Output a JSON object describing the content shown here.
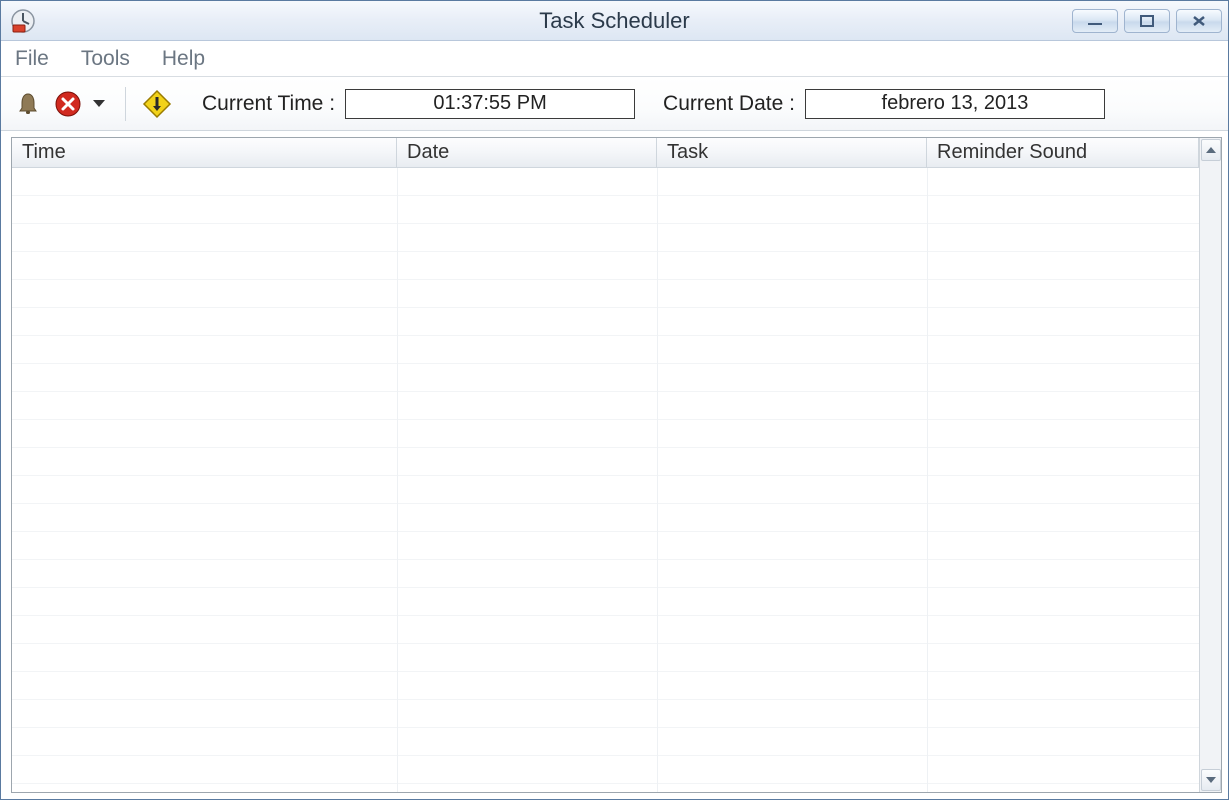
{
  "window": {
    "title": "Task Scheduler"
  },
  "menubar": {
    "items": [
      "File",
      "Tools",
      "Help"
    ]
  },
  "toolbar": {
    "current_time_label": "Current Time :",
    "current_time_value": "01:37:55 PM",
    "current_date_label": "Current Date :",
    "current_date_value": "febrero 13, 2013"
  },
  "table": {
    "columns": [
      "Time",
      "Date",
      "Task",
      "Reminder Sound"
    ],
    "rows": []
  }
}
